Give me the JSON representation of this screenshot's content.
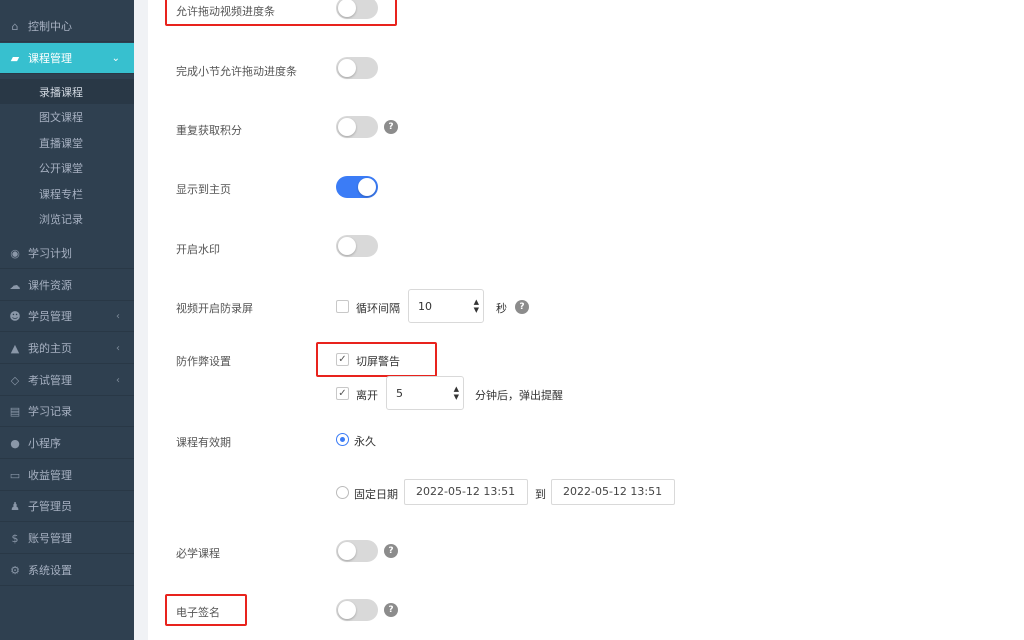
{
  "sidebar": {
    "items": [
      {
        "label": "控制中心",
        "icon": "home-icon"
      },
      {
        "label": "课程管理",
        "icon": "book-icon",
        "active": true
      },
      {
        "label": "学习计划",
        "icon": "eye-icon"
      },
      {
        "label": "课件资源",
        "icon": "cloud-icon"
      },
      {
        "label": "学员管理",
        "icon": "users-icon"
      },
      {
        "label": "我的主页",
        "icon": "graduation-cap-icon"
      },
      {
        "label": "考试管理",
        "icon": "tag-icon"
      },
      {
        "label": "学习记录",
        "icon": "notebook-icon"
      },
      {
        "label": "小程序",
        "icon": "wechat-icon"
      },
      {
        "label": "收益管理",
        "icon": "credit-card-icon"
      },
      {
        "label": "子管理员",
        "icon": "user-lock-icon"
      },
      {
        "label": "账号管理",
        "icon": "dollar-icon"
      },
      {
        "label": "系统设置",
        "icon": "gear-icon"
      }
    ],
    "subitems": [
      "录播课程",
      "图文课程",
      "直播课堂",
      "公开课堂",
      "课程专栏",
      "浏览记录"
    ]
  },
  "settings": {
    "allow_drag": {
      "label": "允许拖动视频进度条",
      "on": false
    },
    "allow_drag_after_section": {
      "label": "完成小节允许拖动进度条",
      "on": false
    },
    "repeat_points": {
      "label": "重复获取积分",
      "on": false
    },
    "show_home": {
      "label": "显示到主页",
      "on": true
    },
    "watermark": {
      "label": "开启水印",
      "on": false
    },
    "anti_record": {
      "label": "视频开启防录屏",
      "loop_label": "循环间隔",
      "interval": "10",
      "unit": "秒"
    },
    "anti_cheat": {
      "label": "防作弊设置",
      "switch_warning": "切屏警告",
      "leave_label": "离开",
      "leave_minutes": "5",
      "leave_suffix": "分钟后，弹出提醒"
    },
    "validity": {
      "label": "课程有效期",
      "forever": "永久",
      "fixed": "固定日期",
      "start": "2022-05-12 13:51",
      "to": "到",
      "end": "2022-05-12 13:51"
    },
    "required": {
      "label": "必学课程",
      "on": false
    },
    "esign": {
      "label": "电子签名",
      "on": false
    }
  },
  "colors": {
    "accent": "#3b7cf6",
    "sidebar_bg": "#2f4050",
    "active_nav": "#37c0cf",
    "highlight": "#e8231d"
  }
}
